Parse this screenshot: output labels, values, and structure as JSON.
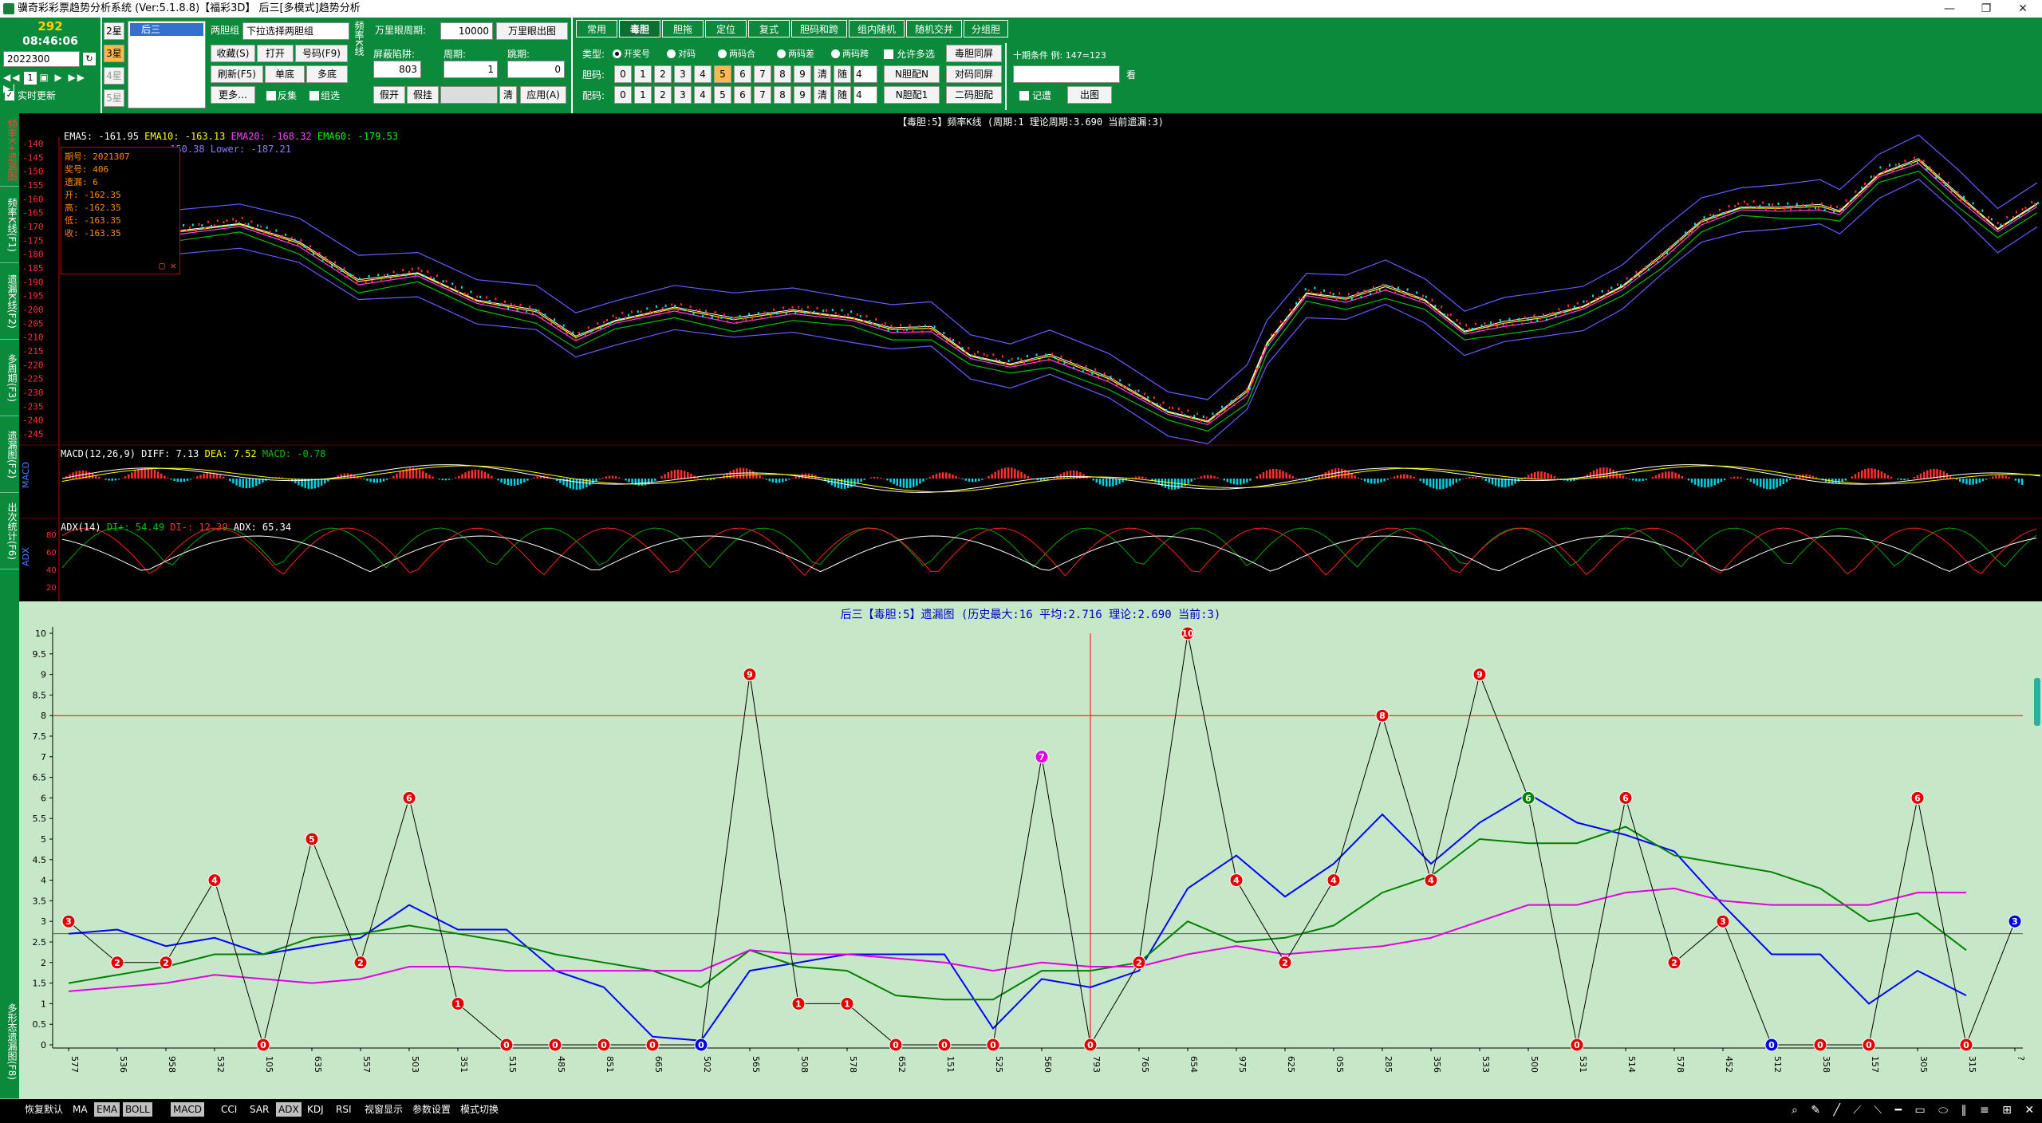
{
  "window": {
    "title": "骥奇彩彩票趋势分析系统 (Ver:5.1.8.8)【福彩3D】    后三[多模式]趋势分析",
    "min": "—",
    "max": "❐",
    "close": "✕"
  },
  "top_left": {
    "count": "292",
    "time": "08:46:06",
    "period": "2022300",
    "auto_refresh": "实时更新",
    "star_buttons": [
      "2星",
      "3星",
      "4星",
      "5星"
    ],
    "list_item": "后三"
  },
  "group": {
    "label": "两胆组",
    "select": "下拉选择两胆组",
    "buttons": [
      "收藏(S)",
      "打开",
      "号码(F9)",
      "刷新(F5)",
      "单底",
      "多底",
      "更多…"
    ],
    "chk_reverse": "反集",
    "chk_multi": "组选"
  },
  "kline": {
    "label": "频率K线",
    "period_label": "万里眼周期:",
    "period_val": "10000",
    "wan_btn": "万里眼出图",
    "trap_label": "屏蔽陷阱:",
    "trap_val": "803",
    "cycle_label": "周期:",
    "cycle_val": "1",
    "jump_label": "跳期:",
    "jump_val": "0",
    "fake_open": "假开",
    "fake_hang": "假挂",
    "clear": "清",
    "apply": "应用(A)"
  },
  "tabs": [
    "常用",
    "毒胆",
    "胆拖",
    "定位",
    "复式",
    "胆码和跨",
    "组内随机",
    "随机交并",
    "分组胆"
  ],
  "types": {
    "label": "类型:",
    "options": [
      "开奖号",
      "对码",
      "两码合",
      "两码差",
      "两码跨"
    ],
    "allow_multi": "允许多选",
    "btn_dudan": "毒胆同屏",
    "btn_nduan": "N胆配N",
    "btn_duima": "对码同屏",
    "btn_nduan1": "N胆配1",
    "btn_erma": "二码胆配",
    "cond_label": "十期条件 例: 147=123",
    "ding": "看",
    "remember": "记遭",
    "chart_btn": "出图"
  },
  "hao": {
    "label": "胆码:",
    "nums": [
      "0",
      "1",
      "2",
      "3",
      "4",
      "5",
      "6",
      "7",
      "8",
      "9"
    ],
    "clear": "清",
    "rand": "随",
    "count": "4"
  },
  "pei": {
    "label": "配码:",
    "nums": [
      "0",
      "1",
      "2",
      "3",
      "4",
      "5",
      "6",
      "7",
      "8",
      "9"
    ],
    "clear": "清",
    "rand": "随",
    "count": "4"
  },
  "left_tabs": [
    "频率K+遗漏图",
    "频率K线(F1)",
    "遗漏K线(F2)",
    "多周期(F3)",
    "遗漏图(F2)",
    "出次统计(F6)",
    "多形态遗漏图(F8)"
  ],
  "kchart": {
    "title": "【毒胆:5】频率K线 (周期:1 理论周期:3.690 当前遗漏:3)",
    "ema_labels": [
      [
        "EMA5: -161.95",
        "#ffffff"
      ],
      [
        "EMA10: -163.13",
        "#ffff00"
      ],
      [
        "EMA20: -168.32",
        "#ff40ff"
      ],
      [
        "EMA60: -179.53",
        "#00ff00"
      ]
    ],
    "boll_label": "-150.38  Lower: -187.21",
    "info": [
      "期号: 2021307",
      "奖号: 406",
      "遗漏: 6",
      "开: -162.35",
      "高: -162.35",
      "低: -163.35",
      "收: -163.35"
    ],
    "y_ticks": [
      "-140",
      "-145",
      "-150",
      "-155",
      "-160",
      "-165",
      "-170",
      "-175",
      "-180",
      "-185",
      "-190",
      "-195",
      "-200",
      "-205",
      "-210",
      "-215",
      "-220",
      "-225",
      "-230",
      "-235",
      "-240",
      "-245"
    ],
    "macd_label": "MACD(12,26,9)  DIFF: 7.13",
    "macd_dea": "DEA: 7.52",
    "macd_val": "MACD: -0.78",
    "macd_axis": "MACD",
    "adx_label": "ADX(14)",
    "adx_di1": "DI+: 54.49",
    "adx_di2": "DI-: 12.39",
    "adx_val": "ADX: 65.34",
    "adx_axis": "ADX",
    "adx_ticks": [
      "80",
      "60",
      "40",
      "20"
    ]
  },
  "chart_data": {
    "type": "line",
    "title": "后三【毒胆:5】遗漏图 (历史最大:16 平均:2.716 理论:2.690 当前:3)",
    "ylim": [
      0,
      10
    ],
    "y_ticks": [
      "0",
      "0.5",
      "1",
      "1.5",
      "2",
      "2.5",
      "3",
      "3.5",
      "4",
      "4.5",
      "5",
      "5.5",
      "6",
      "6.5",
      "7",
      "7.5",
      "8",
      "8.5",
      "9",
      "9.5",
      "10"
    ],
    "red_line": 8,
    "gray_line": 2.7,
    "x": [
      "577",
      "536",
      "958",
      "532",
      "105",
      "635",
      "557",
      "503",
      "351",
      "515",
      "485",
      "851",
      "665",
      "502",
      "565",
      "508",
      "578",
      "652",
      "151",
      "525",
      "560",
      "793",
      "765",
      "654",
      "975",
      "625",
      "055",
      "285",
      "356",
      "533",
      "500",
      "531",
      "514",
      "578",
      "452",
      "512",
      "358",
      "157",
      "305",
      "315",
      "?"
    ],
    "series": [
      {
        "values": [
          3,
          2,
          2,
          4,
          0,
          5,
          2,
          6,
          1,
          0,
          0,
          0,
          0,
          0,
          9,
          1,
          1,
          0,
          0,
          0,
          7,
          0,
          2,
          10,
          4,
          2,
          4,
          8,
          4,
          9,
          6,
          0,
          6,
          2,
          3,
          0,
          0,
          0,
          6,
          0,
          3
        ]
      },
      {
        "values": [
          2.7,
          2.8,
          2.4,
          2.6,
          2.2,
          null,
          2.6,
          3.4,
          2.8,
          2.8,
          1.8,
          1.4,
          0.2,
          0.1,
          1.8,
          2.0,
          2.2,
          2.2,
          2.2,
          0.4,
          1.6,
          1.4,
          1.8,
          3.8,
          4.6,
          3.6,
          4.4,
          5.6,
          4.4,
          5.4,
          6.1,
          5.4,
          5.1,
          4.7,
          3.4,
          2.2,
          2.2,
          1.0,
          1.8,
          1.2,
          null
        ]
      },
      {
        "values": [
          1.5,
          1.7,
          1.9,
          2.2,
          2.2,
          2.6,
          2.7,
          2.9,
          2.7,
          2.5,
          2.2,
          2.0,
          1.8,
          1.4,
          2.3,
          1.9,
          1.8,
          1.2,
          1.1,
          1.1,
          1.8,
          1.8,
          2.0,
          3.0,
          2.5,
          2.6,
          2.9,
          3.7,
          4.1,
          5.0,
          4.9,
          4.9,
          5.3,
          4.6,
          4.4,
          4.2,
          3.8,
          3.0,
          3.2,
          2.3,
          null
        ]
      },
      {
        "values": [
          1.3,
          1.4,
          1.5,
          1.7,
          1.6,
          1.5,
          1.6,
          1.9,
          1.9,
          1.8,
          1.8,
          1.8,
          1.8,
          1.8,
          2.3,
          2.2,
          2.2,
          2.1,
          2.0,
          1.8,
          2.0,
          1.9,
          1.9,
          2.2,
          2.4,
          2.2,
          2.3,
          2.4,
          2.6,
          3.0,
          3.4,
          3.4,
          3.7,
          3.8,
          3.5,
          3.4,
          3.4,
          3.4,
          3.7,
          3.7,
          null
        ]
      }
    ],
    "colors": [
      "#000000",
      "#0000ff",
      "#008000",
      "#e000e0"
    ]
  },
  "statusbar": {
    "items": [
      "恢复默认",
      "MA",
      "EMA",
      "BOLL",
      "MACD",
      "CCI",
      "SAR",
      "ADX",
      "KDJ",
      "RSI",
      "视窗显示",
      "参数设置",
      "模式切换"
    ],
    "highlight": [
      "EMA",
      "BOLL",
      "MACD",
      "ADX"
    ]
  },
  "colors": {
    "green": "#0a8a3a",
    "panel_bg": "#c7e8c8",
    "red": "#ff0000",
    "orange": "#ffb84a"
  }
}
